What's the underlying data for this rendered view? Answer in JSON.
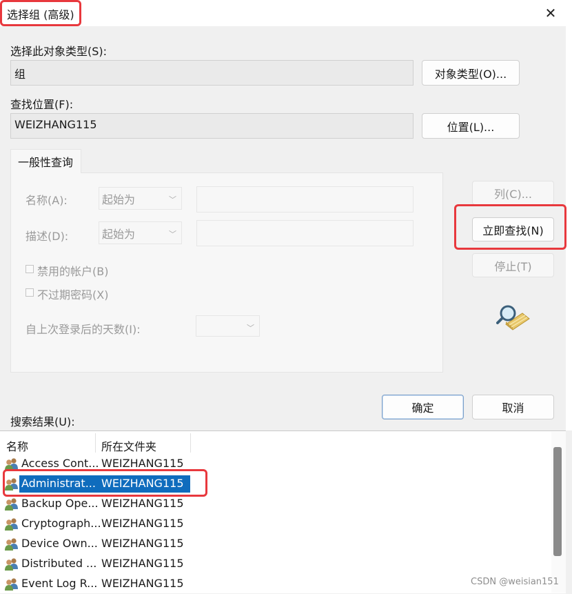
{
  "window": {
    "title": "选择组 (高级)",
    "close_glyph": "✕"
  },
  "object_type": {
    "label": "选择此对象类型(S):",
    "value": "组",
    "button": "对象类型(O)..."
  },
  "location": {
    "label": "查找位置(F):",
    "value": "WEIZHANG115",
    "button": "位置(L)..."
  },
  "general_query": {
    "tab": "一般性查询",
    "name_label": "名称(A):",
    "name_mode": "起始为",
    "desc_label": "描述(D):",
    "desc_mode": "起始为",
    "disabled_accounts": "禁用的帐户(B)",
    "non_expiring_pwd": "不过期密码(X)",
    "days_since_logon": "自上次登录后的天数(I):"
  },
  "actions": {
    "columns": "列(C)...",
    "find_now": "立即查找(N)",
    "stop": "停止(T)",
    "ok": "确定",
    "cancel": "取消"
  },
  "results": {
    "label": "搜索结果(U):",
    "columns": [
      "名称",
      "所在文件夹"
    ],
    "rows": [
      {
        "name": "Access Cont...",
        "folder": "WEIZHANG115",
        "selected": false
      },
      {
        "name": "Administrat...",
        "folder": "WEIZHANG115",
        "selected": true
      },
      {
        "name": "Backup Ope...",
        "folder": "WEIZHANG115",
        "selected": false
      },
      {
        "name": "Cryptograph...",
        "folder": "WEIZHANG115",
        "selected": false
      },
      {
        "name": "Device Own...",
        "folder": "WEIZHANG115",
        "selected": false
      },
      {
        "name": "Distributed ...",
        "folder": "WEIZHANG115",
        "selected": false
      },
      {
        "name": "Event Log R...",
        "folder": "WEIZHANG115",
        "selected": false
      }
    ]
  },
  "icons": {
    "search_icon": "magnifier-over-folder-icon",
    "row_icon": "users-group-icon"
  },
  "colors": {
    "selection": "#0f6cbd",
    "highlight_box": "#e8383d"
  },
  "watermark": "CSDN @weisian151"
}
